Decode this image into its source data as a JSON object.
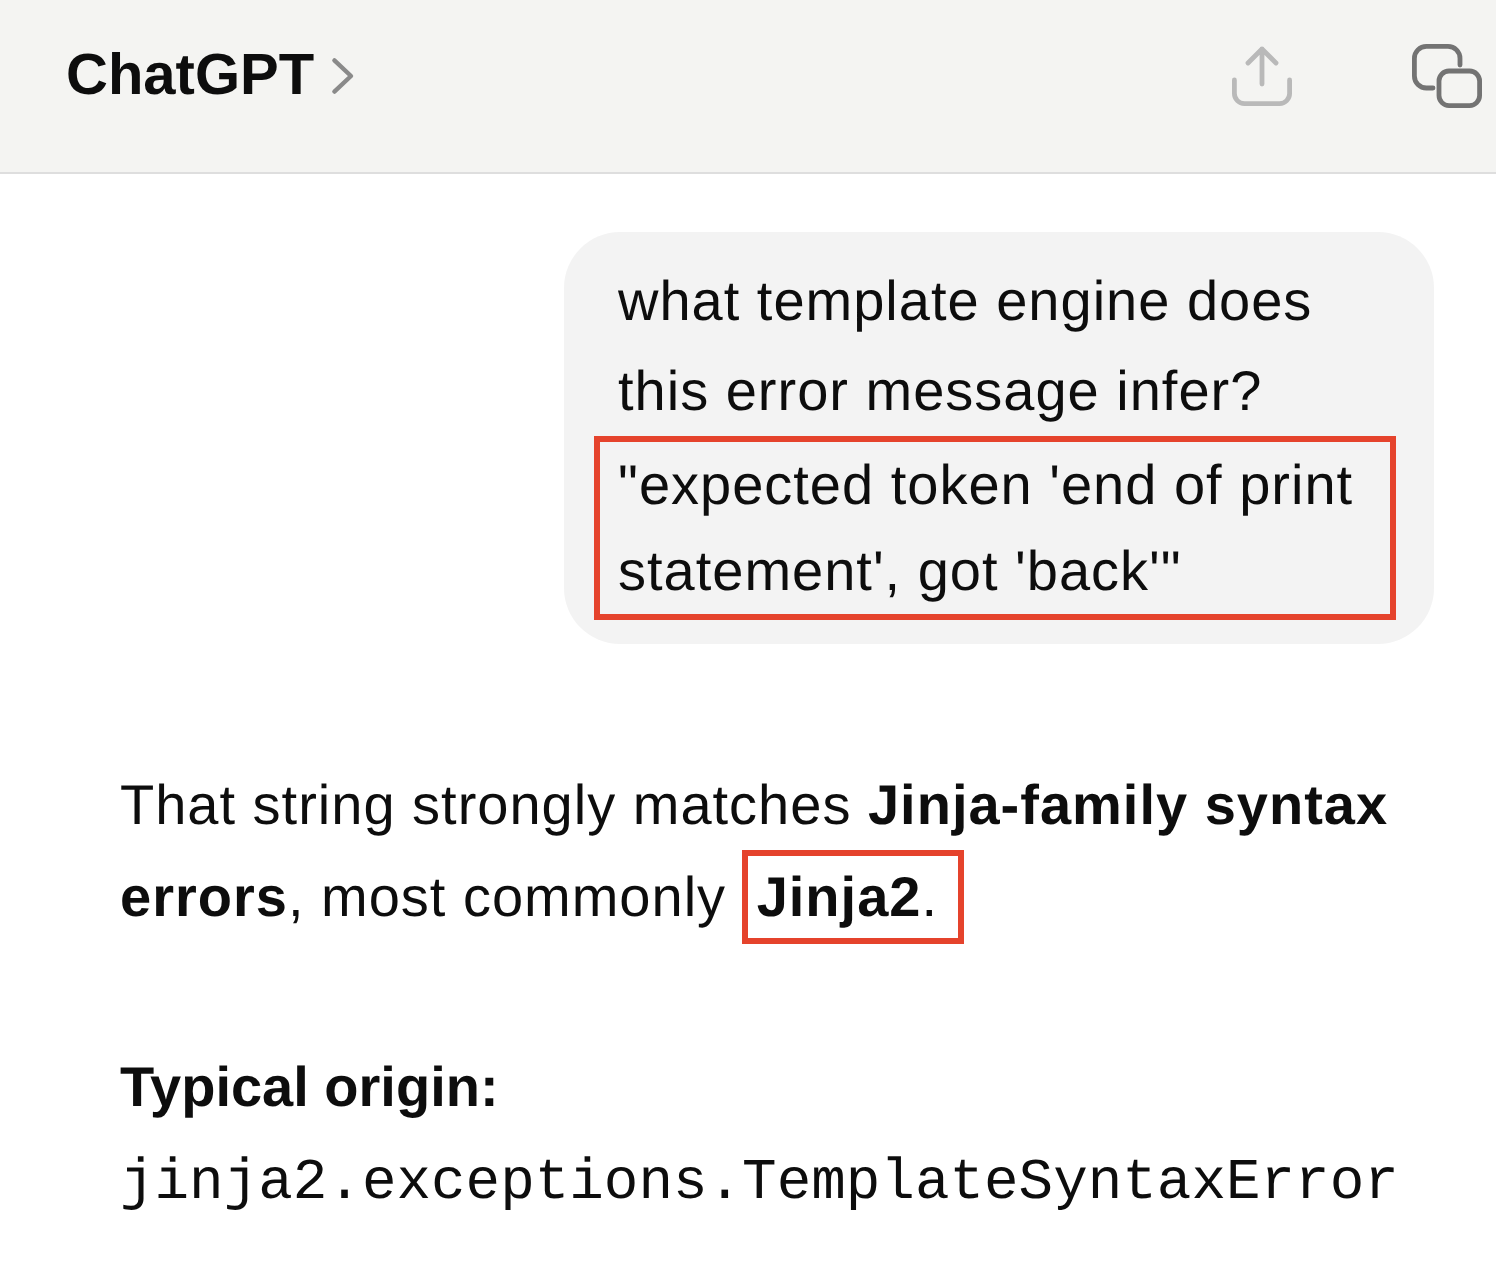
{
  "header": {
    "title": "ChatGPT",
    "actions": [
      {
        "kind": "share",
        "disabled": true
      },
      {
        "kind": "copy",
        "disabled": false
      }
    ]
  },
  "messages": [
    {
      "kind": "user",
      "text": "what template engine does this error message infer?",
      "quote": "\"expected token 'end of print statement', got 'back'\"",
      "quote_highlighted": true
    },
    {
      "kind": "assistant",
      "segments": [
        {
          "text": "That string strongly matches **Jinja-family syntax errors**, most commonly",
          "highlighted": false
        },
        {
          "text": "**Jinja2**.",
          "highlighted": true
        }
      ],
      "origin_label": "Typical origin:",
      "code": "jinja2.exceptions.TemplateSyntaxError"
    }
  ]
}
